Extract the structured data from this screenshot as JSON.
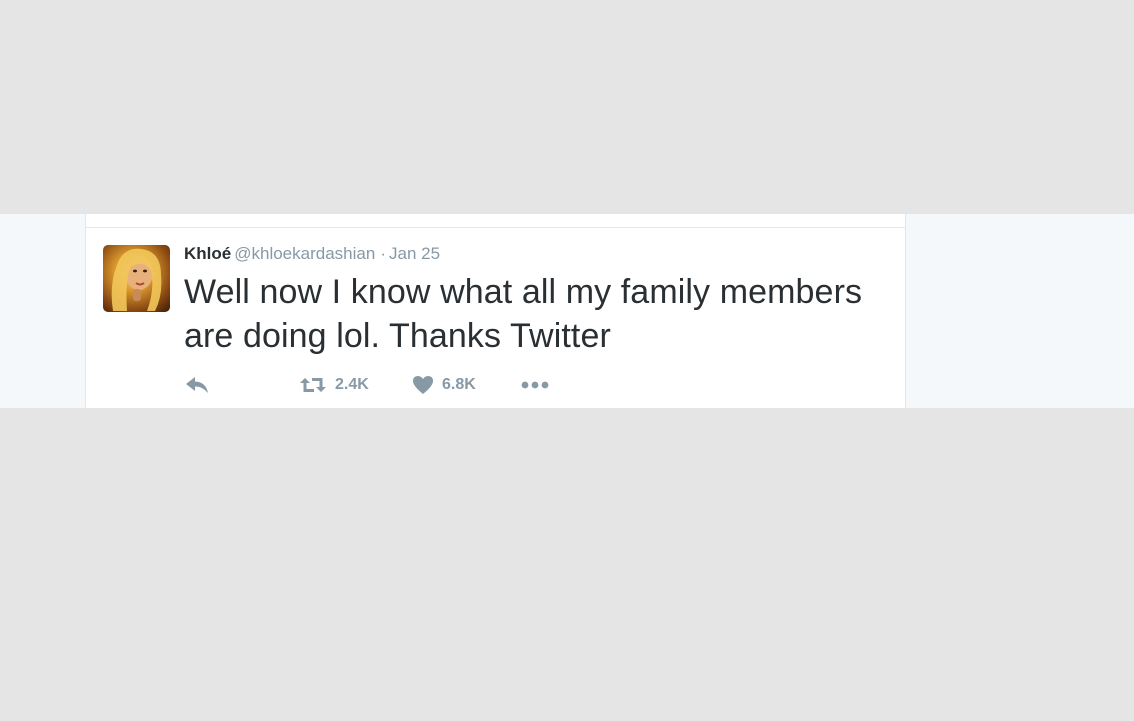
{
  "tweet": {
    "author_name": "Khloé",
    "author_handle": "@khloekardashian",
    "separator": "·",
    "date": "Jan 25",
    "text": "Well now I know what all my family members are doing lol. Thanks Twitter"
  },
  "actions": {
    "reply_icon": "reply-icon",
    "retweet_icon": "retweet-icon",
    "retweet_count": "2.4K",
    "like_icon": "heart-icon",
    "like_count": "6.8K",
    "more_icon": "more-dots-icon"
  },
  "colors": {
    "page_background": "#e5e5e5",
    "strip_background": "#f5f8fa",
    "card_background": "#ffffff",
    "text_primary": "#292f33",
    "text_secondary": "#8899a6"
  }
}
